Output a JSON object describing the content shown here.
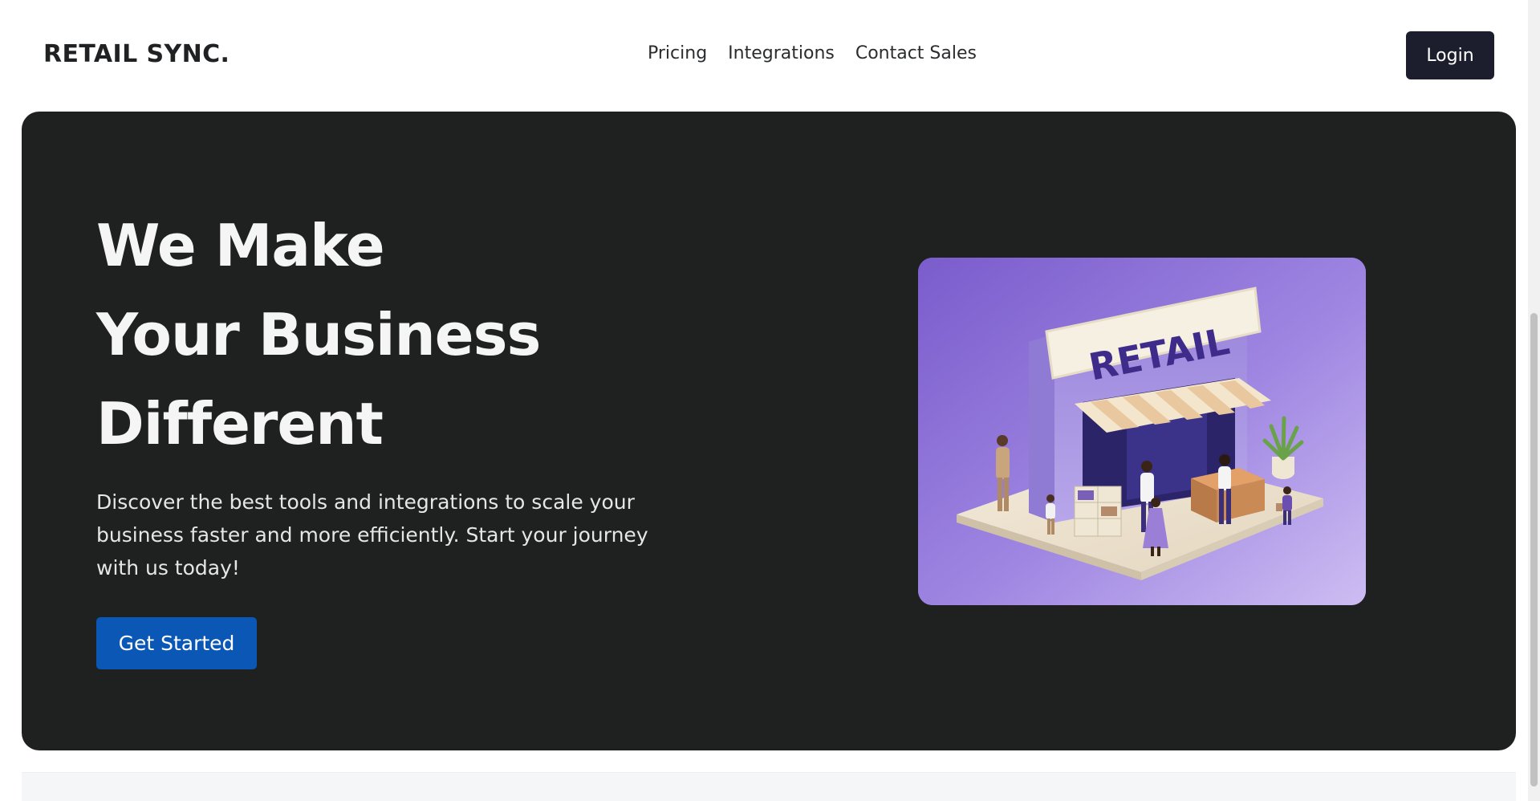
{
  "header": {
    "logo": "RETAIL SYNC.",
    "nav": [
      {
        "label": "Pricing"
      },
      {
        "label": "Integrations"
      },
      {
        "label": "Contact Sales"
      }
    ],
    "login_label": "Login"
  },
  "hero": {
    "title_lines": [
      "We Make",
      "Your Business",
      "Different"
    ],
    "description": "Discover the best tools and integrations to scale your business faster and more efficiently. Start your journey with us today!",
    "cta_label": "Get Started",
    "image": {
      "sign_text": "RETAIL"
    }
  },
  "colors": {
    "hero_background": "#1f2121",
    "login_button": "#1c1e2e",
    "cta_button": "#0b57b6",
    "illustration_purple": "#8a6ad8"
  },
  "icons": {
    "illustration": "retail-storefront-illustration"
  }
}
